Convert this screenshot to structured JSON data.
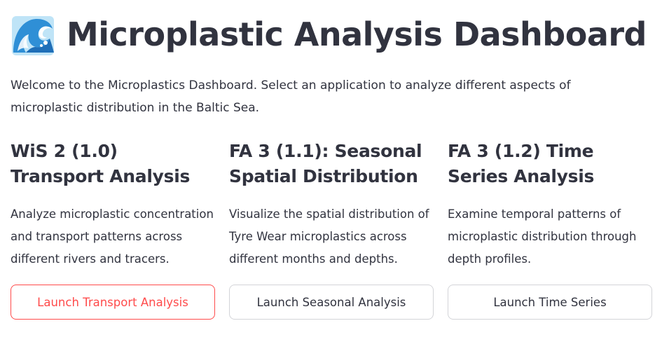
{
  "header": {
    "icon": "ocean-wave-icon",
    "title": "Microplastic Analysis Dashboard"
  },
  "intro": "Welcome to the Microplastics Dashboard. Select an application to analyze different aspects of microplastic distribution in the Baltic Sea.",
  "apps": [
    {
      "title": "WiS 2 (1.0) Transport Analysis",
      "description": "Analyze microplastic concentration and transport patterns across different rivers and tracers.",
      "button": "Launch Transport Analysis",
      "state": "focused"
    },
    {
      "title": "FA 3 (1.1): Seasonal Spatial Distribution",
      "description": "Visualize the spatial distribution of Tyre Wear microplastics across different months and depths.",
      "button": "Launch Seasonal Analysis",
      "state": "default"
    },
    {
      "title": "FA 3 (1.2) Time Series Analysis",
      "description": "Examine temporal patterns of microplastic distribution through depth profiles.",
      "button": "Launch Time Series",
      "state": "default"
    }
  ],
  "colors": {
    "text": "#31333f",
    "accent": "#ff4b4b",
    "button_border": "#d3d4d8",
    "wave_blue": "#3aa0e0"
  }
}
